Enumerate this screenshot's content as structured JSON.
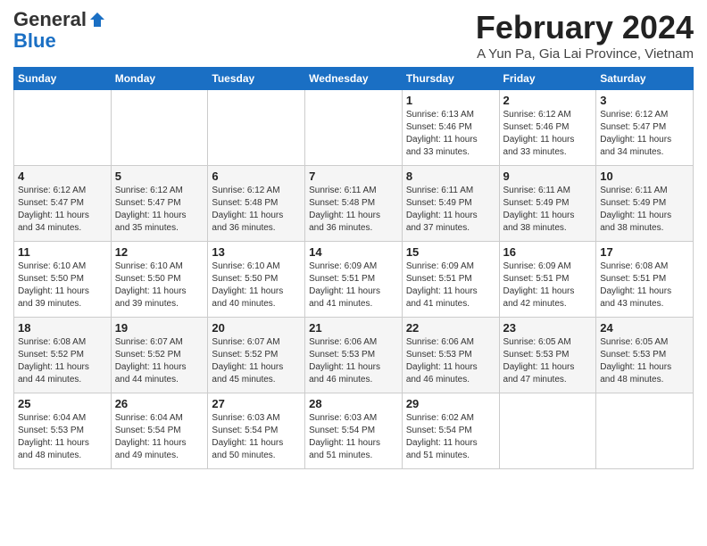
{
  "header": {
    "logo_general": "General",
    "logo_blue": "Blue",
    "main_title": "February 2024",
    "subtitle": "A Yun Pa, Gia Lai Province, Vietnam"
  },
  "calendar": {
    "days_of_week": [
      "Sunday",
      "Monday",
      "Tuesday",
      "Wednesday",
      "Thursday",
      "Friday",
      "Saturday"
    ],
    "weeks": [
      [
        {
          "day": "",
          "detail": ""
        },
        {
          "day": "",
          "detail": ""
        },
        {
          "day": "",
          "detail": ""
        },
        {
          "day": "",
          "detail": ""
        },
        {
          "day": "1",
          "detail": "Sunrise: 6:13 AM\nSunset: 5:46 PM\nDaylight: 11 hours\nand 33 minutes."
        },
        {
          "day": "2",
          "detail": "Sunrise: 6:12 AM\nSunset: 5:46 PM\nDaylight: 11 hours\nand 33 minutes."
        },
        {
          "day": "3",
          "detail": "Sunrise: 6:12 AM\nSunset: 5:47 PM\nDaylight: 11 hours\nand 34 minutes."
        }
      ],
      [
        {
          "day": "4",
          "detail": "Sunrise: 6:12 AM\nSunset: 5:47 PM\nDaylight: 11 hours\nand 34 minutes."
        },
        {
          "day": "5",
          "detail": "Sunrise: 6:12 AM\nSunset: 5:47 PM\nDaylight: 11 hours\nand 35 minutes."
        },
        {
          "day": "6",
          "detail": "Sunrise: 6:12 AM\nSunset: 5:48 PM\nDaylight: 11 hours\nand 36 minutes."
        },
        {
          "day": "7",
          "detail": "Sunrise: 6:11 AM\nSunset: 5:48 PM\nDaylight: 11 hours\nand 36 minutes."
        },
        {
          "day": "8",
          "detail": "Sunrise: 6:11 AM\nSunset: 5:49 PM\nDaylight: 11 hours\nand 37 minutes."
        },
        {
          "day": "9",
          "detail": "Sunrise: 6:11 AM\nSunset: 5:49 PM\nDaylight: 11 hours\nand 38 minutes."
        },
        {
          "day": "10",
          "detail": "Sunrise: 6:11 AM\nSunset: 5:49 PM\nDaylight: 11 hours\nand 38 minutes."
        }
      ],
      [
        {
          "day": "11",
          "detail": "Sunrise: 6:10 AM\nSunset: 5:50 PM\nDaylight: 11 hours\nand 39 minutes."
        },
        {
          "day": "12",
          "detail": "Sunrise: 6:10 AM\nSunset: 5:50 PM\nDaylight: 11 hours\nand 39 minutes."
        },
        {
          "day": "13",
          "detail": "Sunrise: 6:10 AM\nSunset: 5:50 PM\nDaylight: 11 hours\nand 40 minutes."
        },
        {
          "day": "14",
          "detail": "Sunrise: 6:09 AM\nSunset: 5:51 PM\nDaylight: 11 hours\nand 41 minutes."
        },
        {
          "day": "15",
          "detail": "Sunrise: 6:09 AM\nSunset: 5:51 PM\nDaylight: 11 hours\nand 41 minutes."
        },
        {
          "day": "16",
          "detail": "Sunrise: 6:09 AM\nSunset: 5:51 PM\nDaylight: 11 hours\nand 42 minutes."
        },
        {
          "day": "17",
          "detail": "Sunrise: 6:08 AM\nSunset: 5:51 PM\nDaylight: 11 hours\nand 43 minutes."
        }
      ],
      [
        {
          "day": "18",
          "detail": "Sunrise: 6:08 AM\nSunset: 5:52 PM\nDaylight: 11 hours\nand 44 minutes."
        },
        {
          "day": "19",
          "detail": "Sunrise: 6:07 AM\nSunset: 5:52 PM\nDaylight: 11 hours\nand 44 minutes."
        },
        {
          "day": "20",
          "detail": "Sunrise: 6:07 AM\nSunset: 5:52 PM\nDaylight: 11 hours\nand 45 minutes."
        },
        {
          "day": "21",
          "detail": "Sunrise: 6:06 AM\nSunset: 5:53 PM\nDaylight: 11 hours\nand 46 minutes."
        },
        {
          "day": "22",
          "detail": "Sunrise: 6:06 AM\nSunset: 5:53 PM\nDaylight: 11 hours\nand 46 minutes."
        },
        {
          "day": "23",
          "detail": "Sunrise: 6:05 AM\nSunset: 5:53 PM\nDaylight: 11 hours\nand 47 minutes."
        },
        {
          "day": "24",
          "detail": "Sunrise: 6:05 AM\nSunset: 5:53 PM\nDaylight: 11 hours\nand 48 minutes."
        }
      ],
      [
        {
          "day": "25",
          "detail": "Sunrise: 6:04 AM\nSunset: 5:53 PM\nDaylight: 11 hours\nand 48 minutes."
        },
        {
          "day": "26",
          "detail": "Sunrise: 6:04 AM\nSunset: 5:54 PM\nDaylight: 11 hours\nand 49 minutes."
        },
        {
          "day": "27",
          "detail": "Sunrise: 6:03 AM\nSunset: 5:54 PM\nDaylight: 11 hours\nand 50 minutes."
        },
        {
          "day": "28",
          "detail": "Sunrise: 6:03 AM\nSunset: 5:54 PM\nDaylight: 11 hours\nand 51 minutes."
        },
        {
          "day": "29",
          "detail": "Sunrise: 6:02 AM\nSunset: 5:54 PM\nDaylight: 11 hours\nand 51 minutes."
        },
        {
          "day": "",
          "detail": ""
        },
        {
          "day": "",
          "detail": ""
        }
      ]
    ]
  }
}
